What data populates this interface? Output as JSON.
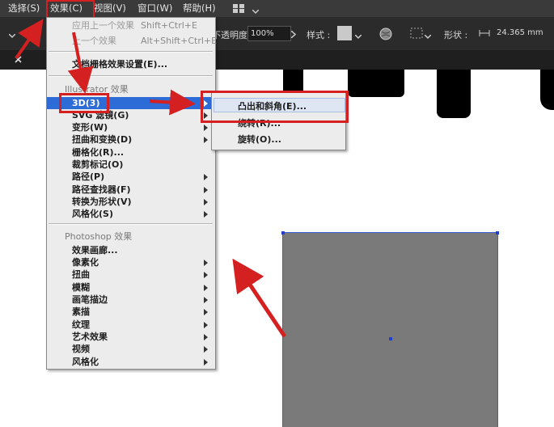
{
  "menubar": {
    "items": [
      "选择(S)",
      "效果(C)",
      "视图(V)",
      "窗口(W)",
      "帮助(H)"
    ]
  },
  "toolbar": {
    "opacity_label": "不透明度 :",
    "opacity_value": "100%",
    "style_label": "样式 :",
    "shape_label": "形状 :",
    "width_value": "24.365 mm"
  },
  "effect_menu": {
    "apply_last": {
      "label": "应用上一个效果",
      "shortcut": "Shift+Ctrl+E"
    },
    "last_effect": {
      "label": "上一个效果",
      "shortcut": "Alt+Shift+Ctrl+E"
    },
    "document_raster": "文档栅格效果设置(E)...",
    "illustrator_header": "Illustrator 效果",
    "illustrator_items": [
      "3D(3)",
      "SVG 滤镜(G)",
      "变形(W)",
      "扭曲和变换(D)",
      "栅格化(R)...",
      "裁剪标记(O)",
      "路径(P)",
      "路径查找器(F)",
      "转换为形状(V)",
      "风格化(S)"
    ],
    "photoshop_header": "Photoshop 效果",
    "photoshop_items": [
      "效果画廊...",
      "像素化",
      "扭曲",
      "模糊",
      "画笔描边",
      "素描",
      "纹理",
      "艺术效果",
      "视频",
      "风格化"
    ]
  },
  "submenu_3d": {
    "items": [
      "凸出和斜角(E)...",
      "绕转(R)...",
      "旋转(O)..."
    ]
  },
  "colors": {
    "highlight": "#2d6bd6",
    "annotation_red": "#d42020",
    "shape_fill": "#7a7a7a"
  }
}
